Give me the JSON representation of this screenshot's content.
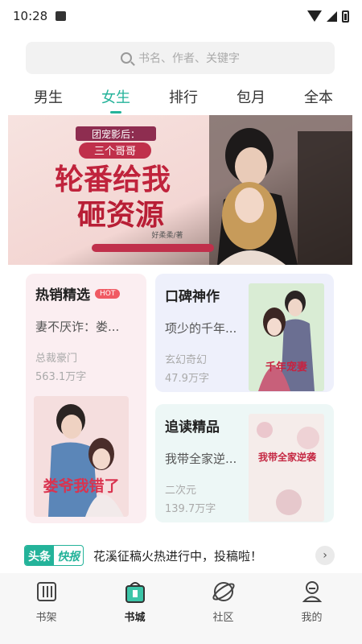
{
  "status": {
    "time": "10:28"
  },
  "search": {
    "placeholder": "书名、作者、关键字"
  },
  "tabs": [
    {
      "label": "男生"
    },
    {
      "label": "女生",
      "active": true
    },
    {
      "label": "排行"
    },
    {
      "label": "包月"
    },
    {
      "label": "全本"
    }
  ],
  "banner": {
    "line1": "团宠影后：",
    "line2": "三个哥哥",
    "line3": "轮番给我",
    "line4": "砸资源",
    "author": "好柔柔/著"
  },
  "cards": {
    "hot": {
      "title": "热销精选",
      "badge": "HOT",
      "book": "妻不厌诈：娄...",
      "genre": "总裁豪门",
      "count": "563.1万字",
      "cover_text": "娄爷我错了"
    },
    "praise": {
      "title": "口碑神作",
      "book": "项少的千年...",
      "genre": "玄幻奇幻",
      "count": "47.9万字",
      "cover_text": "千年宠妻"
    },
    "follow": {
      "title": "追读精品",
      "book": "我带全家逆...",
      "genre": "二次元",
      "count": "139.7万字",
      "cover_text": "我带全家逆袭"
    }
  },
  "news": {
    "tag_a": "头条",
    "tag_b": "快报",
    "text": "花溪征稿火热进行中，投稿啦！"
  },
  "nav": [
    {
      "label": "书架"
    },
    {
      "label": "书城",
      "active": true
    },
    {
      "label": "社区"
    },
    {
      "label": "我的"
    }
  ],
  "colors": {
    "accent": "#25b39a",
    "hot": "#f05a63"
  }
}
